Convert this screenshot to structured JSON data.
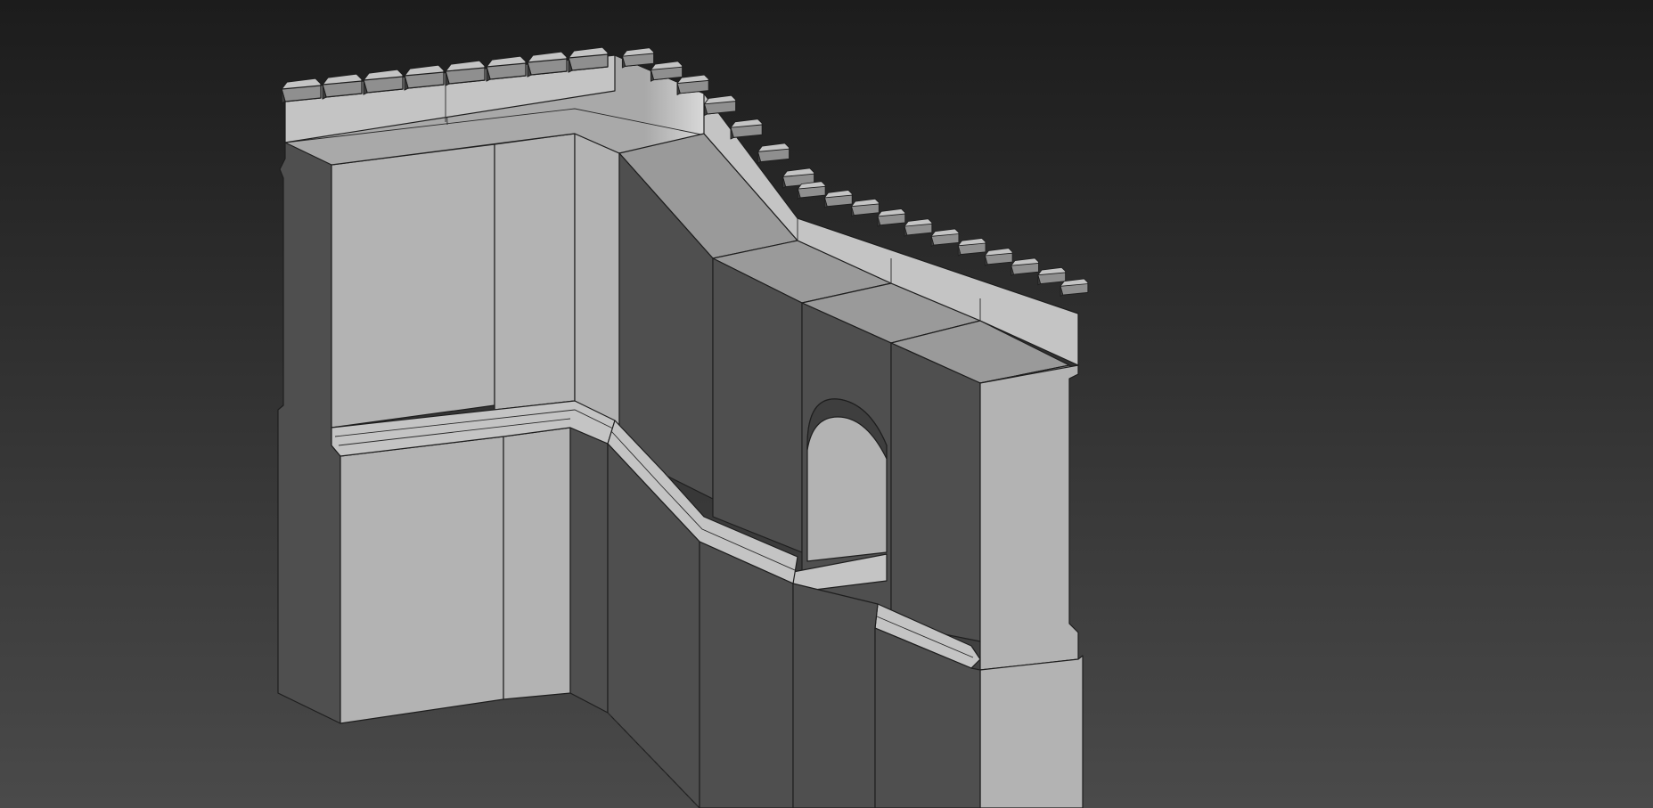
{
  "viewport": {
    "background_top": "#1c1c1c",
    "background_bottom": "#4a4a4a",
    "shading": {
      "lit_face": "#b3b3b3",
      "shadow_face": "#4f4f4f",
      "top_face": "#9a9a9a",
      "edge_line": "#1e1e1e"
    }
  }
}
